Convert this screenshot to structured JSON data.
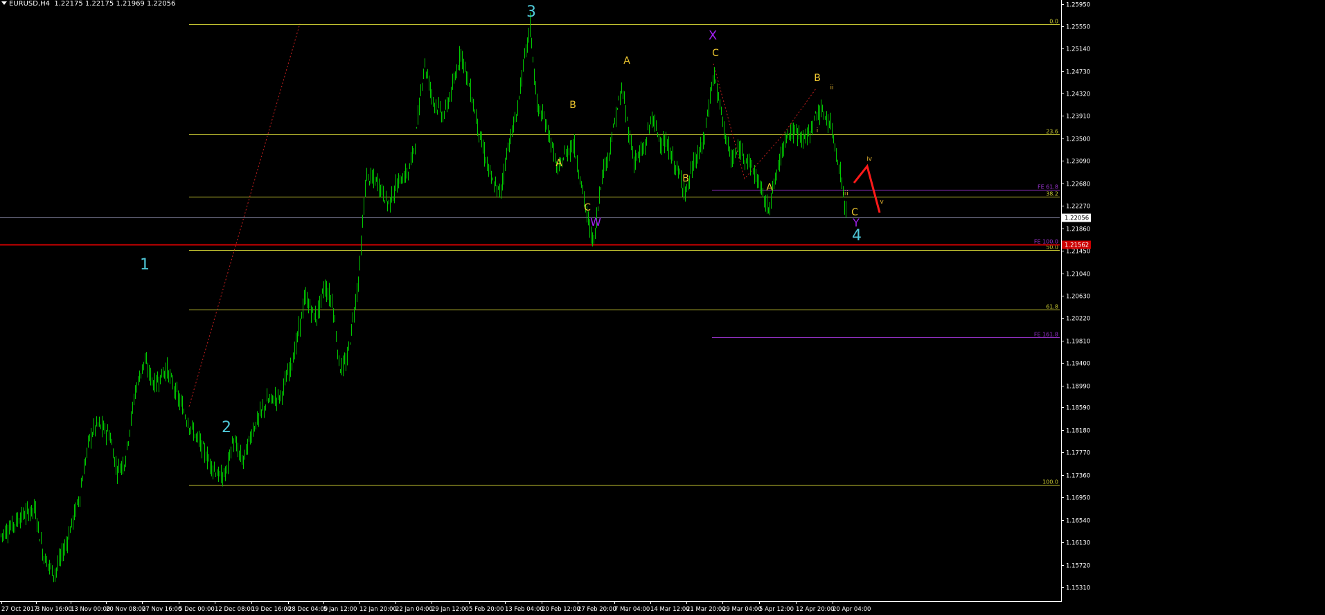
{
  "header": {
    "symbol": "EURUSD,H4",
    "ohlc": "1.22175 1.22175 1.21969 1.22056"
  },
  "colors": {
    "background": "#000000",
    "candles": "#00c800",
    "fib": "#c8c832",
    "fe": "#9933cc",
    "support": "#cc0000",
    "wave_main": "#4fc8d8",
    "wave_sub": "#f0c830",
    "wave_x": "#a020f0",
    "axis_text": "#ffffff",
    "projection": "#ff1a1a"
  },
  "chart_data": {
    "type": "candlestick",
    "series_name": "EURUSD H4",
    "ylim": [
      1.1517,
      1.2599
    ],
    "price_ticks": [
      "1.25950",
      "1.25550",
      "1.25140",
      "1.24730",
      "1.24320",
      "1.23910",
      "1.23500",
      "1.23090",
      "1.22680",
      "1.22270",
      "1.21860",
      "1.21450",
      "1.21040",
      "1.20630",
      "1.20220",
      "1.19810",
      "1.19400",
      "1.18990",
      "1.18590",
      "1.18180",
      "1.17770",
      "1.17360",
      "1.16950",
      "1.16540",
      "1.16130",
      "1.15720",
      "1.15310"
    ],
    "time_labels": [
      "27 Oct 2017",
      "3 Nov 16:00",
      "13 Nov 00:00",
      "20 Nov 08:00",
      "27 Nov 16:00",
      "5 Dec 00:00",
      "12 Dec 08:00",
      "19 Dec 16:00",
      "28 Dec 04:00",
      "5 Jan 12:00",
      "12 Jan 20:00",
      "22 Jan 04:00",
      "29 Jan 12:00",
      "5 Feb 20:00",
      "13 Feb 04:00",
      "20 Feb 12:00",
      "27 Feb 20:00",
      "7 Mar 04:00",
      "14 Mar 12:00",
      "21 Mar 20:00",
      "29 Mar 04:00",
      "5 Apr 12:00",
      "12 Apr 20:00",
      "20 Apr 04:00"
    ],
    "current_price": "1.22056",
    "support_price_label": "1.21562",
    "price_path": [
      [
        0,
        1.1625
      ],
      [
        14,
        1.164
      ],
      [
        30,
        1.166
      ],
      [
        50,
        1.1675
      ],
      [
        62,
        1.159
      ],
      [
        78,
        1.1555
      ],
      [
        95,
        1.161
      ],
      [
        115,
        1.17
      ],
      [
        128,
        1.18
      ],
      [
        140,
        1.183
      ],
      [
        158,
        1.181
      ],
      [
        168,
        1.1745
      ],
      [
        180,
        1.176
      ],
      [
        195,
        1.189
      ],
      [
        208,
        1.1945
      ],
      [
        222,
        1.19
      ],
      [
        240,
        1.193
      ],
      [
        256,
        1.188
      ],
      [
        272,
        1.183
      ],
      [
        290,
        1.179
      ],
      [
        302,
        1.176
      ],
      [
        318,
        1.173
      ],
      [
        326,
        1.174
      ],
      [
        336,
        1.18
      ],
      [
        350,
        1.176
      ],
      [
        365,
        1.182
      ],
      [
        385,
        1.187
      ],
      [
        405,
        1.188
      ],
      [
        425,
        1.196
      ],
      [
        440,
        1.206
      ],
      [
        456,
        1.202
      ],
      [
        468,
        1.208
      ],
      [
        480,
        1.205
      ],
      [
        490,
        1.193
      ],
      [
        500,
        1.194
      ],
      [
        508,
        1.201
      ],
      [
        518,
        1.21
      ],
      [
        528,
        1.228
      ],
      [
        545,
        1.227
      ],
      [
        560,
        1.223
      ],
      [
        575,
        1.227
      ],
      [
        590,
        1.229
      ],
      [
        600,
        1.235
      ],
      [
        612,
        1.249
      ],
      [
        625,
        1.242
      ],
      [
        640,
        1.239
      ],
      [
        655,
        1.245
      ],
      [
        665,
        1.251
      ],
      [
        680,
        1.243
      ],
      [
        695,
        1.234
      ],
      [
        710,
        1.227
      ],
      [
        722,
        1.225
      ],
      [
        732,
        1.233
      ],
      [
        745,
        1.239
      ],
      [
        755,
        1.248
      ],
      [
        765,
        1.2555
      ],
      [
        775,
        1.241
      ],
      [
        790,
        1.237
      ],
      [
        805,
        1.229
      ],
      [
        815,
        1.232
      ],
      [
        828,
        1.234
      ],
      [
        840,
        1.226
      ],
      [
        850,
        1.219
      ],
      [
        857,
        1.216
      ],
      [
        868,
        1.228
      ],
      [
        880,
        1.233
      ],
      [
        890,
        1.24
      ],
      [
        898,
        1.244
      ],
      [
        905,
        1.238
      ],
      [
        915,
        1.231
      ],
      [
        930,
        1.233
      ],
      [
        940,
        1.239
      ],
      [
        952,
        1.235
      ],
      [
        965,
        1.233
      ],
      [
        978,
        1.229
      ],
      [
        990,
        1.225
      ],
      [
        1000,
        1.23
      ],
      [
        1015,
        1.234
      ],
      [
        1030,
        1.247
      ],
      [
        1045,
        1.237
      ],
      [
        1055,
        1.231
      ],
      [
        1068,
        1.233
      ],
      [
        1080,
        1.231
      ],
      [
        1095,
        1.227
      ],
      [
        1108,
        1.222
      ],
      [
        1120,
        1.228
      ],
      [
        1135,
        1.236
      ],
      [
        1150,
        1.236
      ],
      [
        1165,
        1.235
      ],
      [
        1180,
        1.24
      ],
      [
        1192,
        1.239
      ],
      [
        1200,
        1.237
      ],
      [
        1208,
        1.232
      ],
      [
        1215,
        1.227
      ],
      [
        1222,
        1.2205
      ]
    ],
    "fib_levels": [
      {
        "label": "0.0",
        "price": 1.2558
      },
      {
        "label": "23.6",
        "price": 1.2357
      },
      {
        "label": "38.2",
        "price": 1.2244
      },
      {
        "label": "50.0",
        "price": 1.2147
      },
      {
        "label": "61.8",
        "price": 1.2038
      },
      {
        "label": "100.0",
        "price": 1.1718
      }
    ],
    "fe_levels": [
      {
        "label": "FE 61.8",
        "price": 1.2256
      },
      {
        "label": "FE 100.0",
        "price": 1.2156
      },
      {
        "label": "FE 161.8",
        "price": 1.1987
      }
    ],
    "wave_labels": [
      {
        "text": "1",
        "kind": "main"
      },
      {
        "text": "2",
        "kind": "main"
      },
      {
        "text": "3",
        "kind": "main"
      },
      {
        "text": "4",
        "kind": "main"
      },
      {
        "text": "X",
        "kind": "x"
      },
      {
        "text": "W",
        "kind": "x"
      },
      {
        "text": "Y",
        "kind": "x"
      },
      {
        "text": "A",
        "kind": "sub"
      },
      {
        "text": "B",
        "kind": "sub"
      },
      {
        "text": "C",
        "kind": "sub"
      },
      {
        "text": "A",
        "kind": "sub"
      },
      {
        "text": "B",
        "kind": "sub"
      },
      {
        "text": "C",
        "kind": "sub"
      },
      {
        "text": "A",
        "kind": "sub"
      },
      {
        "text": "B",
        "kind": "sub"
      },
      {
        "text": "C",
        "kind": "sub"
      },
      {
        "text": "i",
        "kind": "minor"
      },
      {
        "text": "ii",
        "kind": "minor"
      },
      {
        "text": "iii",
        "kind": "minor"
      },
      {
        "text": "iv",
        "kind": "minor"
      },
      {
        "text": "v",
        "kind": "minor"
      }
    ]
  }
}
